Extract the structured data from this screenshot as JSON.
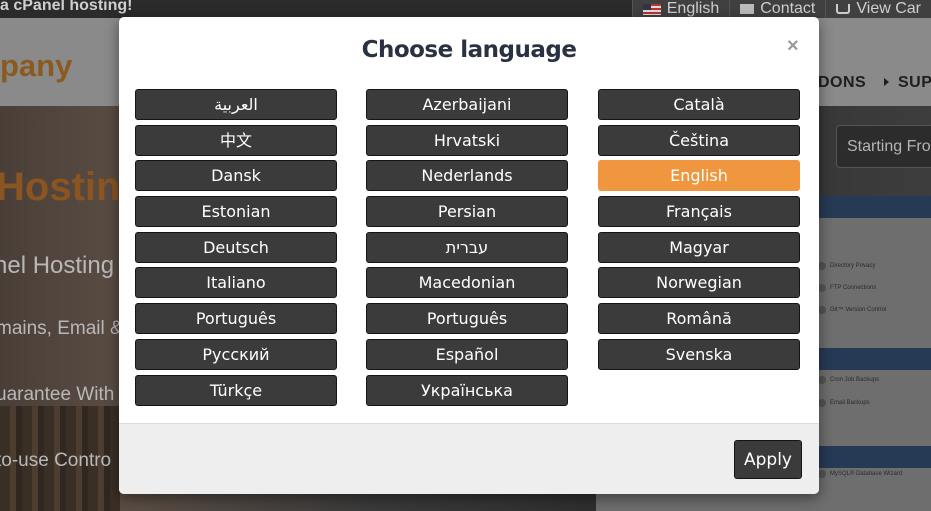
{
  "background": {
    "promo_text": "a cPanel hosting!",
    "top_links": {
      "language": "English",
      "contact": "Contact",
      "cart": "View Car"
    },
    "logo_text": "pany",
    "nav": [
      "DONS",
      "SUP"
    ],
    "hero": {
      "title": "Hosting",
      "subtitle": "nel Hosting",
      "line": "mains, Email &",
      "guarantee": "uarantee With",
      "control": "to-use Contro"
    },
    "starting_from": "Starting Fro",
    "cpanel_items": [
      "Directory Privacy",
      "FTP Connections",
      "Git™ Version Control",
      "Cron Job Backups",
      "Email Backups",
      "MySQL® Database Wizard"
    ]
  },
  "modal": {
    "title": "Choose language",
    "close_symbol": "×",
    "columns": [
      [
        "العربية",
        "中文",
        "Dansk",
        "Estonian",
        "Deutsch",
        "Italiano",
        "Português",
        "Русский",
        "Türkçe"
      ],
      [
        "Azerbaijani",
        "Hrvatski",
        "Nederlands",
        "Persian",
        "עברית",
        "Macedonian",
        "Português",
        "Español",
        "Українська"
      ],
      [
        "Català",
        "Čeština",
        "English",
        "Français",
        "Magyar",
        "Norwegian",
        "Română",
        "Svenska"
      ]
    ],
    "selected": "English",
    "apply_label": "Apply"
  },
  "colors": {
    "accent": "#f0963f",
    "button_bg": "#3b3b3b",
    "title": "#2a3140"
  }
}
